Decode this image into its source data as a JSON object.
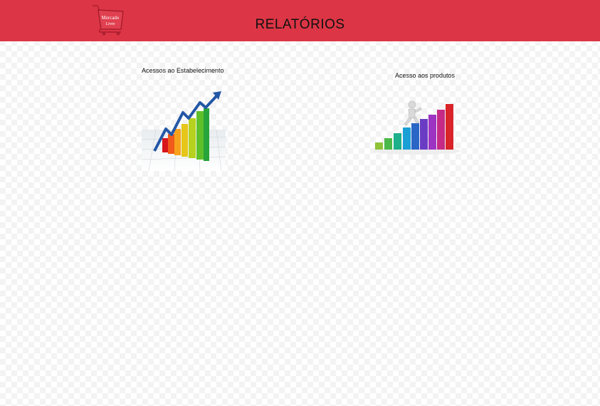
{
  "header": {
    "title": "RELATÓRIOS",
    "logo_text": [
      "Mercado",
      "Livre"
    ],
    "background": "#dc3545",
    "logo_icon": "shopping-cart-icon"
  },
  "reports": [
    {
      "label": "Acessos ao Estabelecimento",
      "image": "growth-bar-chart-arrow-image"
    },
    {
      "label": "Acesso aos produtos",
      "image": "stair-climber-bar-chart-image"
    }
  ]
}
